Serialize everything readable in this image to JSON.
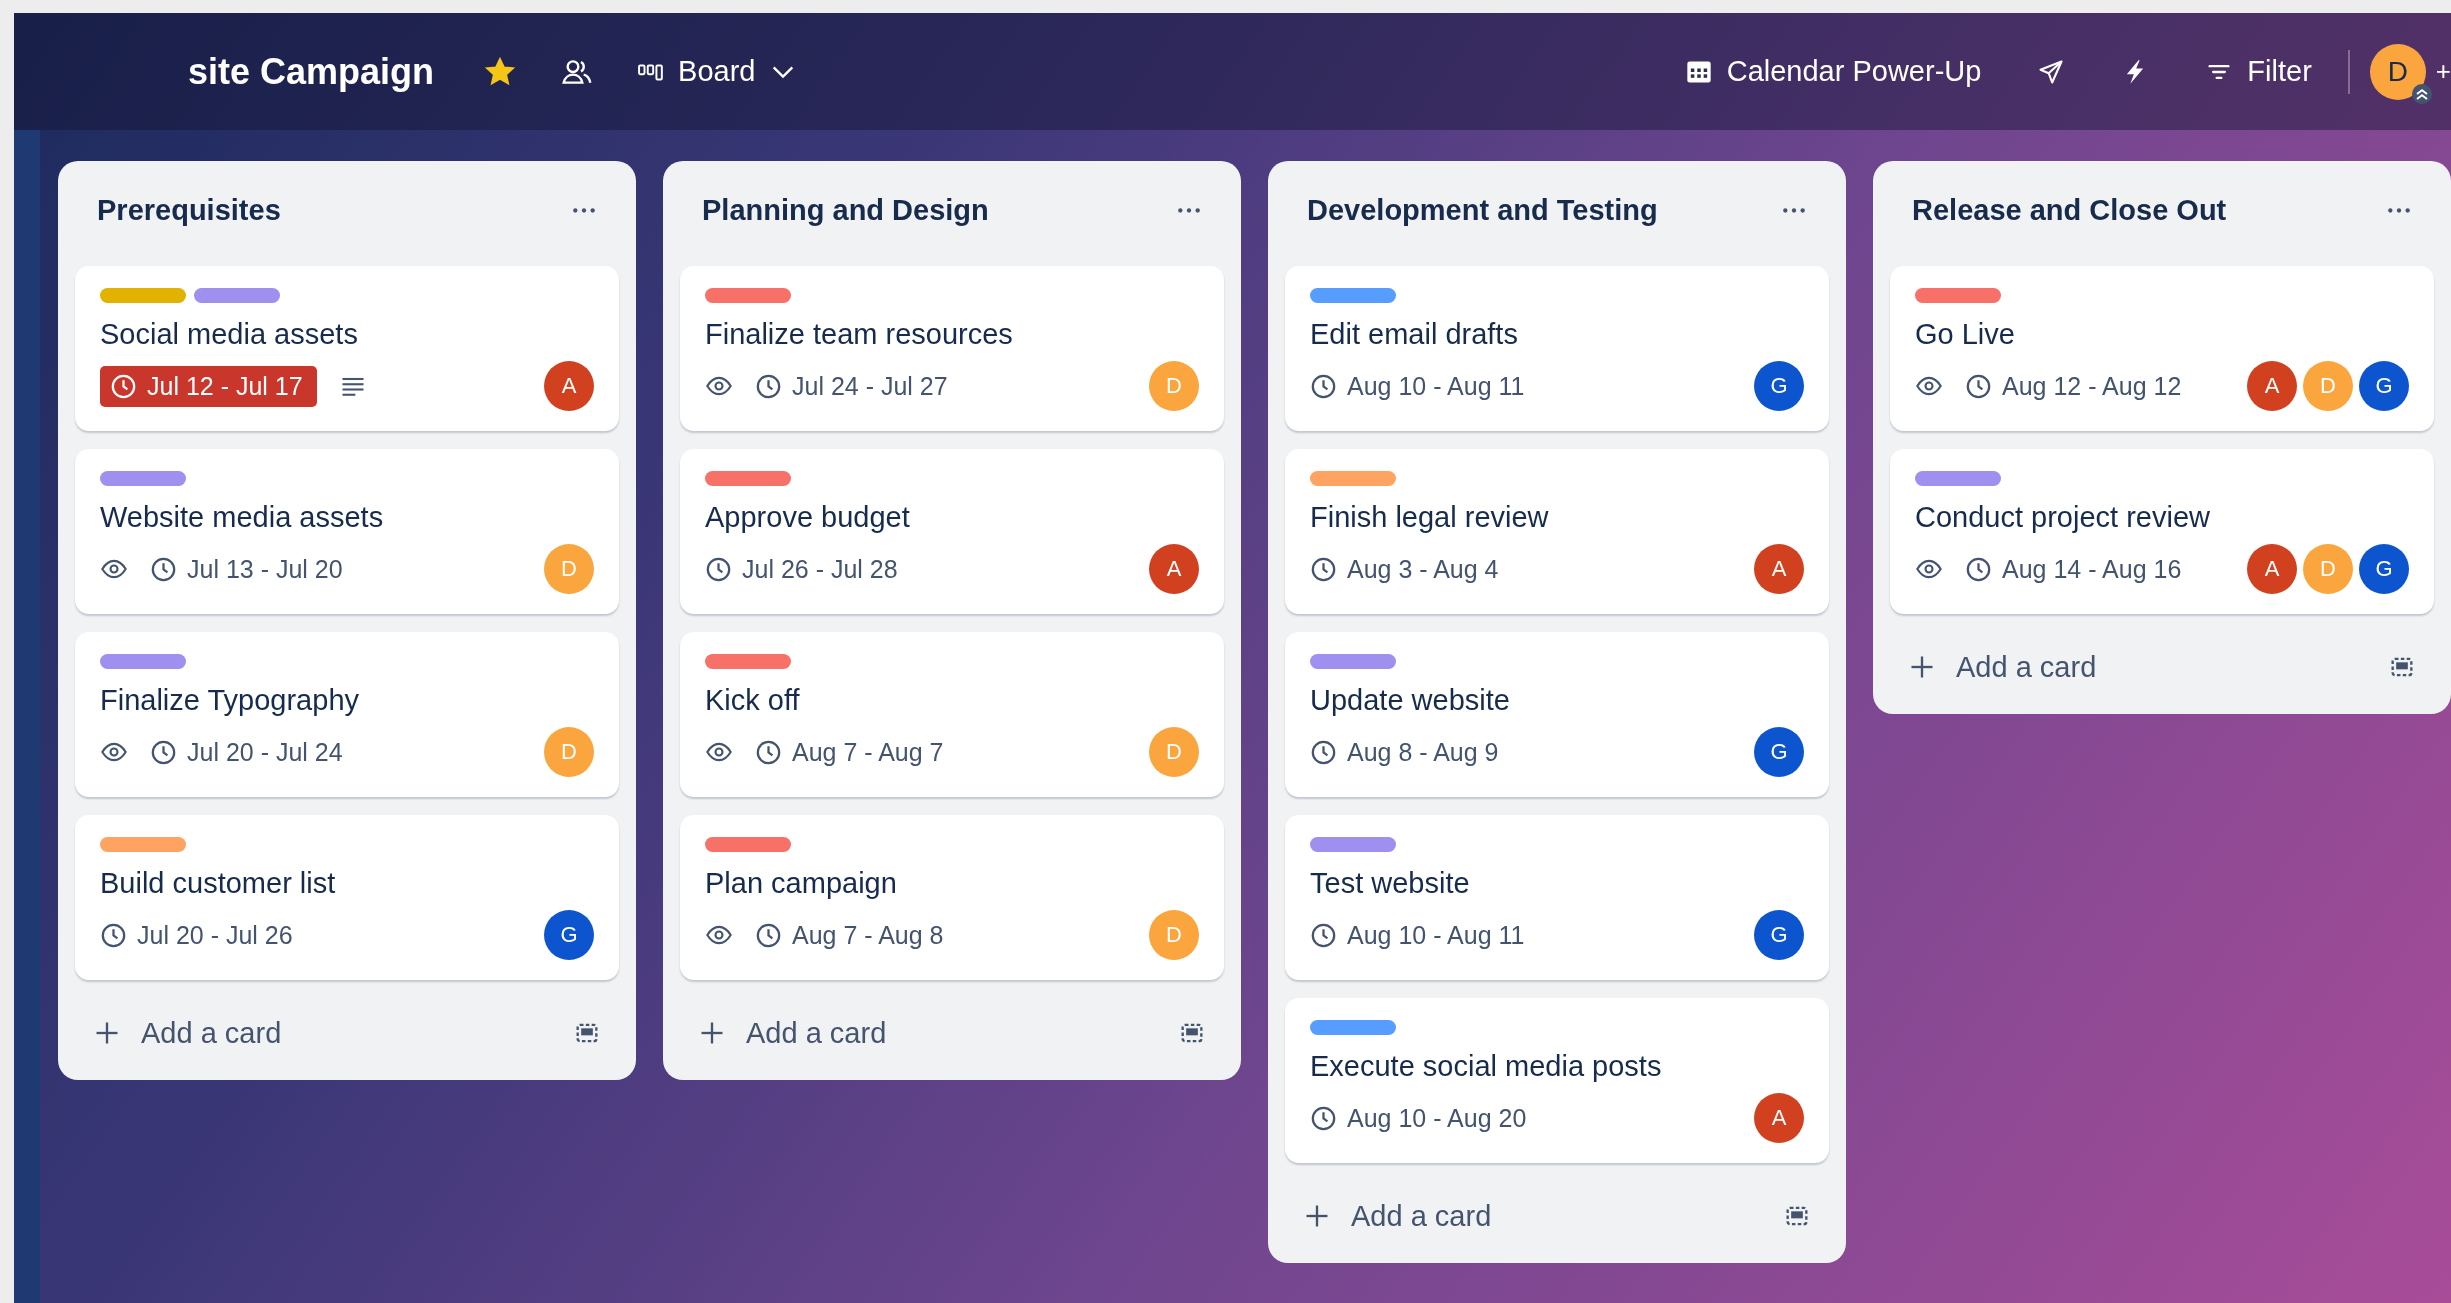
{
  "header": {
    "title": "site Campaign",
    "starred": true,
    "view": "Board",
    "actions": [
      {
        "kind": "calendar",
        "label": "Calendar Power-Up"
      },
      {
        "kind": "send"
      },
      {
        "kind": "bolt"
      },
      {
        "kind": "filter",
        "label": "Filter"
      }
    ],
    "member": {
      "initial": "D",
      "color": "#faa53d"
    },
    "more_members": "+"
  },
  "lists": [
    {
      "title": "Prerequisites",
      "add_label": "Add a card",
      "cards": [
        {
          "labels": [
            {
              "color": "#e2b203"
            },
            {
              "color": "#9f8fef"
            }
          ],
          "title": "Social media assets",
          "watching": false,
          "dates": "Jul 12 - Jul 17",
          "overdue": true,
          "description": true,
          "members": [
            {
              "initial": "A",
              "color": "#d1401f"
            }
          ]
        },
        {
          "labels": [
            {
              "color": "#9f8fef"
            }
          ],
          "title": "Website media assets",
          "watching": true,
          "dates": "Jul 13 - Jul 20",
          "overdue": false,
          "description": false,
          "members": [
            {
              "initial": "D",
              "color": "#faa53d"
            }
          ]
        },
        {
          "labels": [
            {
              "color": "#9f8fef"
            }
          ],
          "title": "Finalize Typography",
          "watching": true,
          "dates": "Jul 20 - Jul 24",
          "overdue": false,
          "description": false,
          "members": [
            {
              "initial": "D",
              "color": "#faa53d"
            }
          ]
        },
        {
          "labels": [
            {
              "color": "#fea362"
            }
          ],
          "title": "Build customer list",
          "watching": false,
          "dates": "Jul 20 - Jul 26",
          "overdue": false,
          "description": false,
          "members": [
            {
              "initial": "G",
              "color": "#0c55cf"
            }
          ]
        }
      ]
    },
    {
      "title": "Planning and Design",
      "add_label": "Add a card",
      "cards": [
        {
          "labels": [
            {
              "color": "#f87168"
            }
          ],
          "title": "Finalize team resources",
          "watching": true,
          "dates": "Jul 24 - Jul 27",
          "overdue": false,
          "description": false,
          "members": [
            {
              "initial": "D",
              "color": "#faa53d"
            }
          ]
        },
        {
          "labels": [
            {
              "color": "#f87168"
            }
          ],
          "title": "Approve budget",
          "watching": false,
          "dates": "Jul 26 - Jul 28",
          "overdue": false,
          "description": false,
          "members": [
            {
              "initial": "A",
              "color": "#d1401f"
            }
          ]
        },
        {
          "labels": [
            {
              "color": "#f87168"
            }
          ],
          "title": "Kick off",
          "watching": true,
          "dates": "Aug 7 - Aug 7",
          "overdue": false,
          "description": false,
          "members": [
            {
              "initial": "D",
              "color": "#faa53d"
            }
          ]
        },
        {
          "labels": [
            {
              "color": "#f87168"
            }
          ],
          "title": "Plan campaign",
          "watching": true,
          "dates": "Aug 7 - Aug 8",
          "overdue": false,
          "description": false,
          "members": [
            {
              "initial": "D",
              "color": "#faa53d"
            }
          ]
        }
      ]
    },
    {
      "title": "Development and Testing",
      "add_label": "Add a card",
      "cards": [
        {
          "labels": [
            {
              "color": "#579dff"
            }
          ],
          "title": "Edit email drafts",
          "watching": false,
          "dates": "Aug 10 - Aug 11",
          "overdue": false,
          "description": false,
          "members": [
            {
              "initial": "G",
              "color": "#0c55cf"
            }
          ]
        },
        {
          "labels": [
            {
              "color": "#fea362"
            }
          ],
          "title": "Finish legal review",
          "watching": false,
          "dates": "Aug 3 - Aug 4",
          "overdue": false,
          "description": false,
          "members": [
            {
              "initial": "A",
              "color": "#d1401f"
            }
          ]
        },
        {
          "labels": [
            {
              "color": "#9f8fef"
            }
          ],
          "title": "Update website",
          "watching": false,
          "dates": "Aug 8 - Aug 9",
          "overdue": false,
          "description": false,
          "members": [
            {
              "initial": "G",
              "color": "#0c55cf"
            }
          ]
        },
        {
          "labels": [
            {
              "color": "#9f8fef"
            }
          ],
          "title": "Test website",
          "watching": false,
          "dates": "Aug 10 - Aug 11",
          "overdue": false,
          "description": false,
          "members": [
            {
              "initial": "G",
              "color": "#0c55cf"
            }
          ]
        },
        {
          "labels": [
            {
              "color": "#579dff"
            }
          ],
          "title": "Execute social media posts",
          "watching": false,
          "dates": "Aug 10 - Aug 20",
          "overdue": false,
          "description": false,
          "members": [
            {
              "initial": "A",
              "color": "#d1401f"
            }
          ]
        }
      ]
    },
    {
      "title": "Release and Close Out",
      "add_label": "Add a card",
      "cards": [
        {
          "labels": [
            {
              "color": "#f87168"
            }
          ],
          "title": "Go Live",
          "watching": true,
          "dates": "Aug 12 - Aug 12",
          "overdue": false,
          "description": false,
          "members": [
            {
              "initial": "A",
              "color": "#d1401f"
            },
            {
              "initial": "D",
              "color": "#faa53d"
            },
            {
              "initial": "G",
              "color": "#0c55cf"
            }
          ]
        },
        {
          "labels": [
            {
              "color": "#9f8fef"
            }
          ],
          "title": "Conduct project review",
          "watching": true,
          "dates": "Aug 14 - Aug 16",
          "overdue": false,
          "description": false,
          "members": [
            {
              "initial": "A",
              "color": "#d1401f"
            },
            {
              "initial": "D",
              "color": "#faa53d"
            },
            {
              "initial": "G",
              "color": "#0c55cf"
            }
          ]
        }
      ]
    }
  ]
}
